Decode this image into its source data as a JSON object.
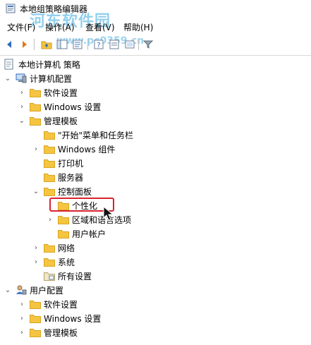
{
  "window": {
    "title": "本地组策略编辑器"
  },
  "watermark": {
    "text": "河东软件园",
    "url": "www.pc0359.cn"
  },
  "menu": {
    "items": [
      "文件(F)",
      "操作(A)",
      "查看(V)",
      "帮助(H)"
    ]
  },
  "tree": {
    "root": "本地计算机 策略",
    "computer_config": "计算机配置",
    "software_settings_1": "软件设置",
    "windows_settings_1": "Windows 设置",
    "admin_templates_1": "管理模板",
    "start_menu": "\"开始\"菜单和任务栏",
    "windows_components": "Windows 组件",
    "printers": "打印机",
    "servers": "服务器",
    "control_panel": "控制面板",
    "personalization": "个性化",
    "regional": "区域和语言选项",
    "user_accounts": "用户帐户",
    "network": "网络",
    "system": "系统",
    "all_settings": "所有设置",
    "user_config": "用户配置",
    "software_settings_2": "软件设置",
    "windows_settings_2": "Windows 设置",
    "admin_templates_2": "管理模板"
  },
  "colors": {
    "folder": "#f5c542",
    "folder_dark": "#d9a520",
    "highlight": "#d9232f",
    "watermark": "#3da9e0"
  }
}
